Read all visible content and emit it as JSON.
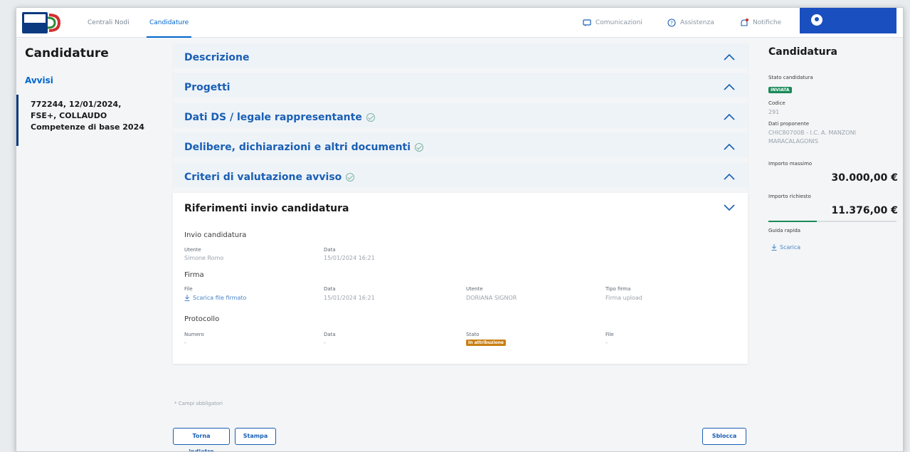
{
  "header": {
    "nav": [
      {
        "label": "Centrali Nodi"
      },
      {
        "label": "Candidature"
      }
    ],
    "actions": {
      "comunicazioni": "Comunicazioni",
      "assistenza": "Assistenza",
      "notifiche": "Notifiche"
    }
  },
  "left": {
    "title": "Candidature",
    "subtitle": "Avvisi",
    "item": "772244, 12/01/2024, FSE+, COLLAUDO Competenze di base 2024"
  },
  "accordions": [
    {
      "label": "Descrizione",
      "check": false
    },
    {
      "label": "Progetti",
      "check": false
    },
    {
      "label": "Dati DS / legale rappresentante",
      "check": true
    },
    {
      "label": "Delibere, dichiarazioni e altri documenti",
      "check": true
    },
    {
      "label": "Criteri di valutazione avviso",
      "check": true
    }
  ],
  "riferimenti": {
    "title": "Riferimenti invio candidatura",
    "invio": {
      "section": "Invio candidatura",
      "utente_label": "Utente",
      "utente_val": "Simone Romo",
      "data_label": "Data",
      "data_val": "15/01/2024 16:21"
    },
    "firma": {
      "section": "Firma",
      "file_label": "File",
      "file_link": "Scarica file firmato",
      "data_label": "Data",
      "data_val": "15/01/2024 16:21",
      "utente_label": "Utente",
      "utente_val": "DORIANA SIGNOR",
      "tipo_label": "Tipo firma",
      "tipo_val": "Firma upload"
    },
    "protocollo": {
      "section": "Protocollo",
      "numero_label": "Numero",
      "numero_val": "-",
      "data_label": "Data",
      "data_val": "-",
      "stato_label": "Stato",
      "stato_badge": "In attribuzione",
      "file_label": "File",
      "file_val": "-"
    }
  },
  "footnote": "* Campi obbligatori",
  "buttons": {
    "back": "Torna indietro",
    "print": "Stampa",
    "unlock": "Sblocca"
  },
  "right": {
    "title": "Candidatura",
    "stato_label": "Stato candidatura",
    "stato_badge": "INVIATA",
    "codice_label": "Codice",
    "codice_val": "291",
    "proponente_label": "Dati proponente",
    "proponente_val": "CHIC80700B - I.C. A. MANZONI MARACALAGONIS",
    "importo_max_label": "Importo massimo",
    "importo_max_val": "30.000,00 €",
    "importo_rich_label": "Importo richiesto",
    "importo_rich_val": "11.376,00 €",
    "importo_progress_fraction": 0.38,
    "guida_label": "Guida rapida",
    "guida_link": "Scarica"
  },
  "colors": {
    "brand_blue": "#1a5fb4",
    "user_box": "#1a4fbf",
    "success": "#1a8a5a",
    "warning": "#c97f12"
  }
}
